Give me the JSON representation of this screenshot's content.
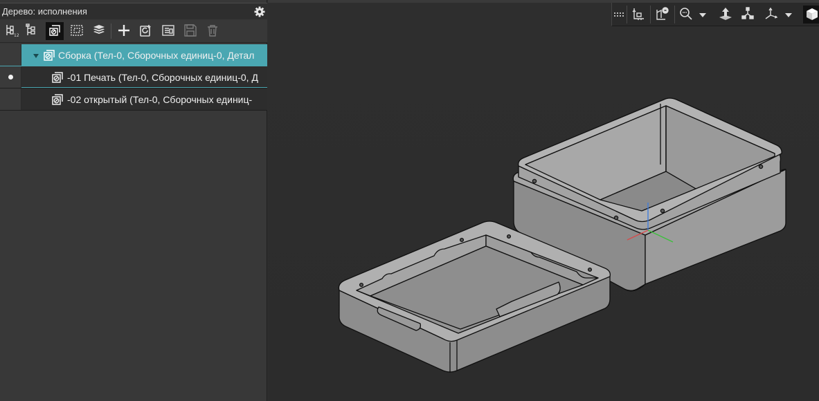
{
  "panel": {
    "title": "Дерево: исполнения"
  },
  "toolbar": {
    "buttons": [
      {
        "name": "tree-structure-button",
        "icon": "tree-structure-icon"
      },
      {
        "name": "tree-list-button",
        "icon": "tree-list-icon"
      },
      {
        "name": "executions-button",
        "icon": "executions-icon",
        "active": true
      },
      {
        "name": "selection-set-button",
        "icon": "selection-set-icon"
      },
      {
        "name": "layers-button",
        "icon": "layers-icon"
      },
      {
        "name": "add-execution-button",
        "icon": "plus-icon"
      },
      {
        "name": "refresh-execution-button",
        "icon": "refresh-icon"
      },
      {
        "name": "execution-properties-button",
        "icon": "properties-icon"
      },
      {
        "name": "save-execution-button",
        "icon": "save-icon",
        "disabled": true
      },
      {
        "name": "delete-execution-button",
        "icon": "trash-icon",
        "disabled": true
      }
    ]
  },
  "tree": {
    "items": [
      {
        "label": "Сборка (Тел-0, Сборочных единиц-0, Детал",
        "level": 0,
        "expanded": true,
        "selected": true,
        "current": false
      },
      {
        "label": "-01 Печать (Тел-0, Сборочных единиц-0, Д",
        "level": 1,
        "expanded": false,
        "selected": false,
        "current": true
      },
      {
        "label": "-02 открытый (Тел-0, Сборочных единиц-",
        "level": 1,
        "expanded": false,
        "selected": false,
        "current": false
      }
    ]
  },
  "viewport": {
    "toolbar": [
      {
        "name": "grip-handle",
        "icon": "grip-icon"
      },
      {
        "name": "orientation-button",
        "icon": "orientation-icon"
      },
      {
        "name": "section-view-button",
        "icon": "section-view-icon"
      },
      {
        "name": "zoom-button",
        "icon": "zoom-icon"
      },
      {
        "name": "zoom-dropdown",
        "icon": "chevron-down-icon"
      },
      {
        "name": "normal-to-button",
        "icon": "normal-to-icon"
      },
      {
        "name": "view-orientation-button",
        "icon": "view-orientation-icon"
      },
      {
        "name": "triad-button",
        "icon": "triad-icon"
      },
      {
        "name": "triad-dropdown",
        "icon": "chevron-down-icon"
      },
      {
        "name": "display-mode-button",
        "icon": "cube-icon"
      }
    ]
  },
  "colors": {
    "selection": "#4aa7b2",
    "panel_bg": "#383838",
    "viewport_bg": "#2d2d2d",
    "model_face": "#9a9a9a",
    "model_edge": "#0f0f0f"
  }
}
